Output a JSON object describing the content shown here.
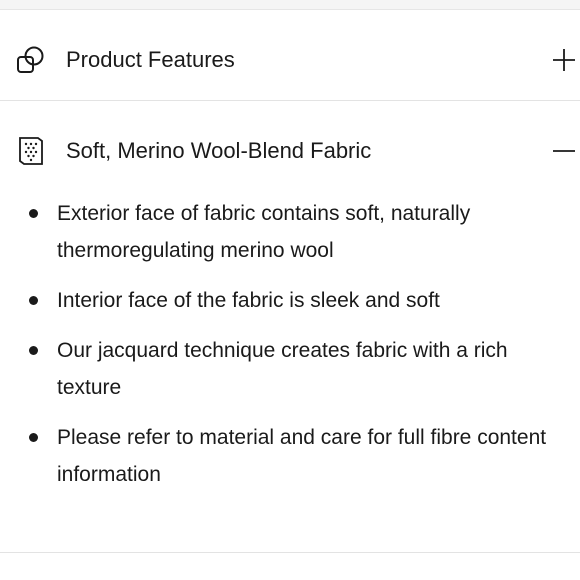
{
  "sections": [
    {
      "label": "Product Features",
      "icon": "overlapping-shapes-icon",
      "state": "collapsed",
      "toggle_icon": "plus-icon"
    },
    {
      "label": "Soft, Merino Wool-Blend Fabric",
      "icon": "fabric-swatch-icon",
      "state": "expanded",
      "toggle_icon": "minus-icon",
      "items": [
        "Exterior face of fabric contains soft, naturally thermoregulating merino wool",
        "Interior face of the fabric is sleek and soft",
        "Our jacquard technique creates fabric with a rich texture",
        "Please refer to material and care for full fibre content information"
      ]
    }
  ],
  "colors": {
    "text": "#1a1a1a",
    "divider": "#e3e3e3",
    "top_strip": "#f5f5f5",
    "background": "#ffffff"
  }
}
